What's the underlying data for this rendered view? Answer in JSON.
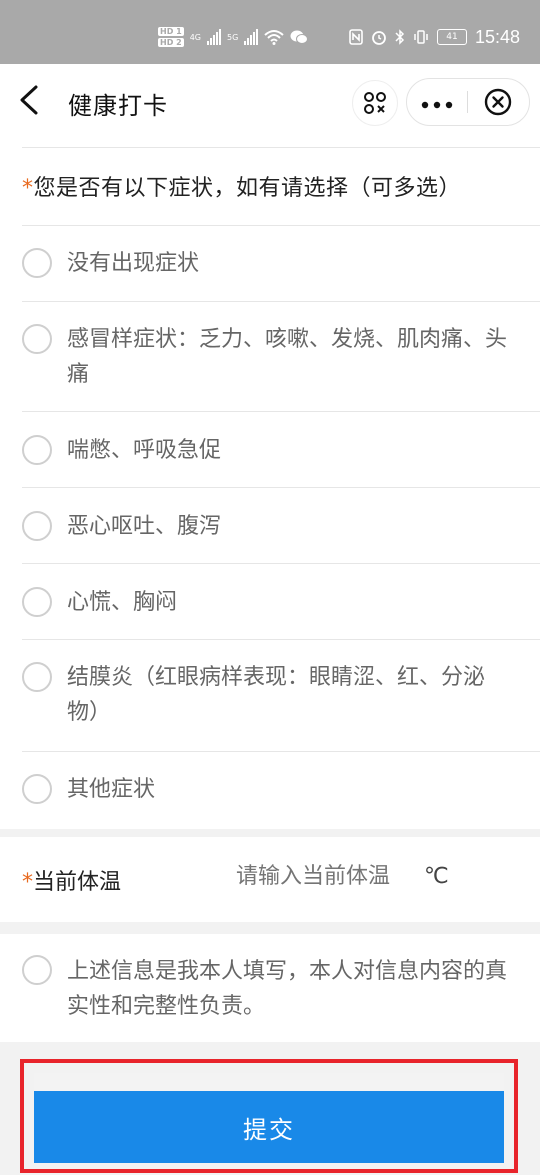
{
  "status_bar": {
    "hd1": "HD 1",
    "hd2": "HD 2",
    "net1": "4G",
    "net2": "5G",
    "battery": "41",
    "time": "15:48"
  },
  "header": {
    "title": "健康打卡"
  },
  "question": {
    "required_mark": "*",
    "text": "您是否有以下症状，如有请选择（可多选）"
  },
  "options": [
    {
      "label": "没有出现症状"
    },
    {
      "label": "感冒样症状：乏力、咳嗽、发烧、肌肉痛、头痛"
    },
    {
      "label": "喘憋、呼吸急促"
    },
    {
      "label": "恶心呕吐、腹泻"
    },
    {
      "label": "心慌、胸闷"
    },
    {
      "label": "结膜炎（红眼病样表现：眼睛涩、红、分泌物）"
    },
    {
      "label": "其他症状"
    }
  ],
  "temperature": {
    "required_mark": "*",
    "label": "当前体温",
    "placeholder": "请输入当前体温",
    "unit": "℃"
  },
  "declaration": {
    "text": "上述信息是我本人填写，本人对信息内容的真实性和完整性负责。"
  },
  "submit": {
    "label": "提交"
  },
  "colors": {
    "accent": "#1989e8",
    "required": "#e86a1f",
    "highlight": "#e8242b"
  }
}
